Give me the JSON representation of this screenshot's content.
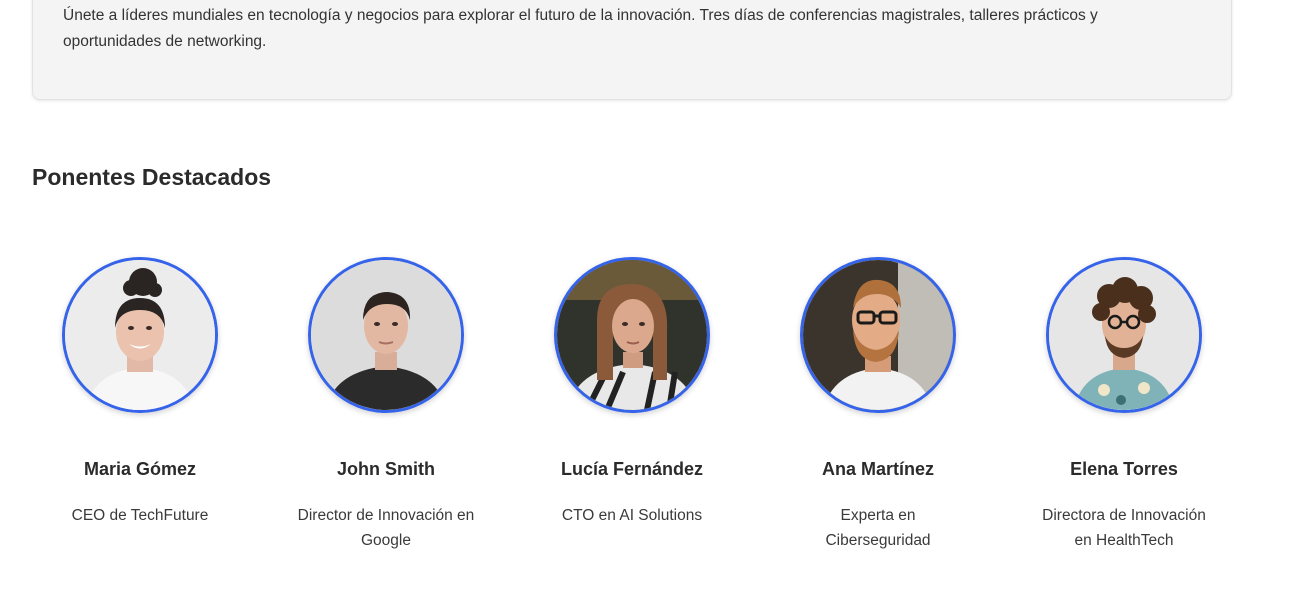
{
  "intro": {
    "description": "Únete a líderes mundiales en tecnología y negocios para explorar el futuro de la innovación. Tres días de conferencias magistrales, talleres prácticos y oportunidades de networking."
  },
  "speakers_section": {
    "title": "Ponentes Destacados",
    "accent_color": "#3563e9",
    "speakers": [
      {
        "name": "Maria Gómez",
        "role": "CEO de TechFuture"
      },
      {
        "name": "John Smith",
        "role": "Director de Innovación en Google"
      },
      {
        "name": "Lucía Fernández",
        "role": "CTO en AI Solutions"
      },
      {
        "name": "Ana Martínez",
        "role": "Experta en Ciberseguridad"
      },
      {
        "name": "Elena Torres",
        "role": "Directora de Innovación en HealthTech"
      }
    ]
  }
}
